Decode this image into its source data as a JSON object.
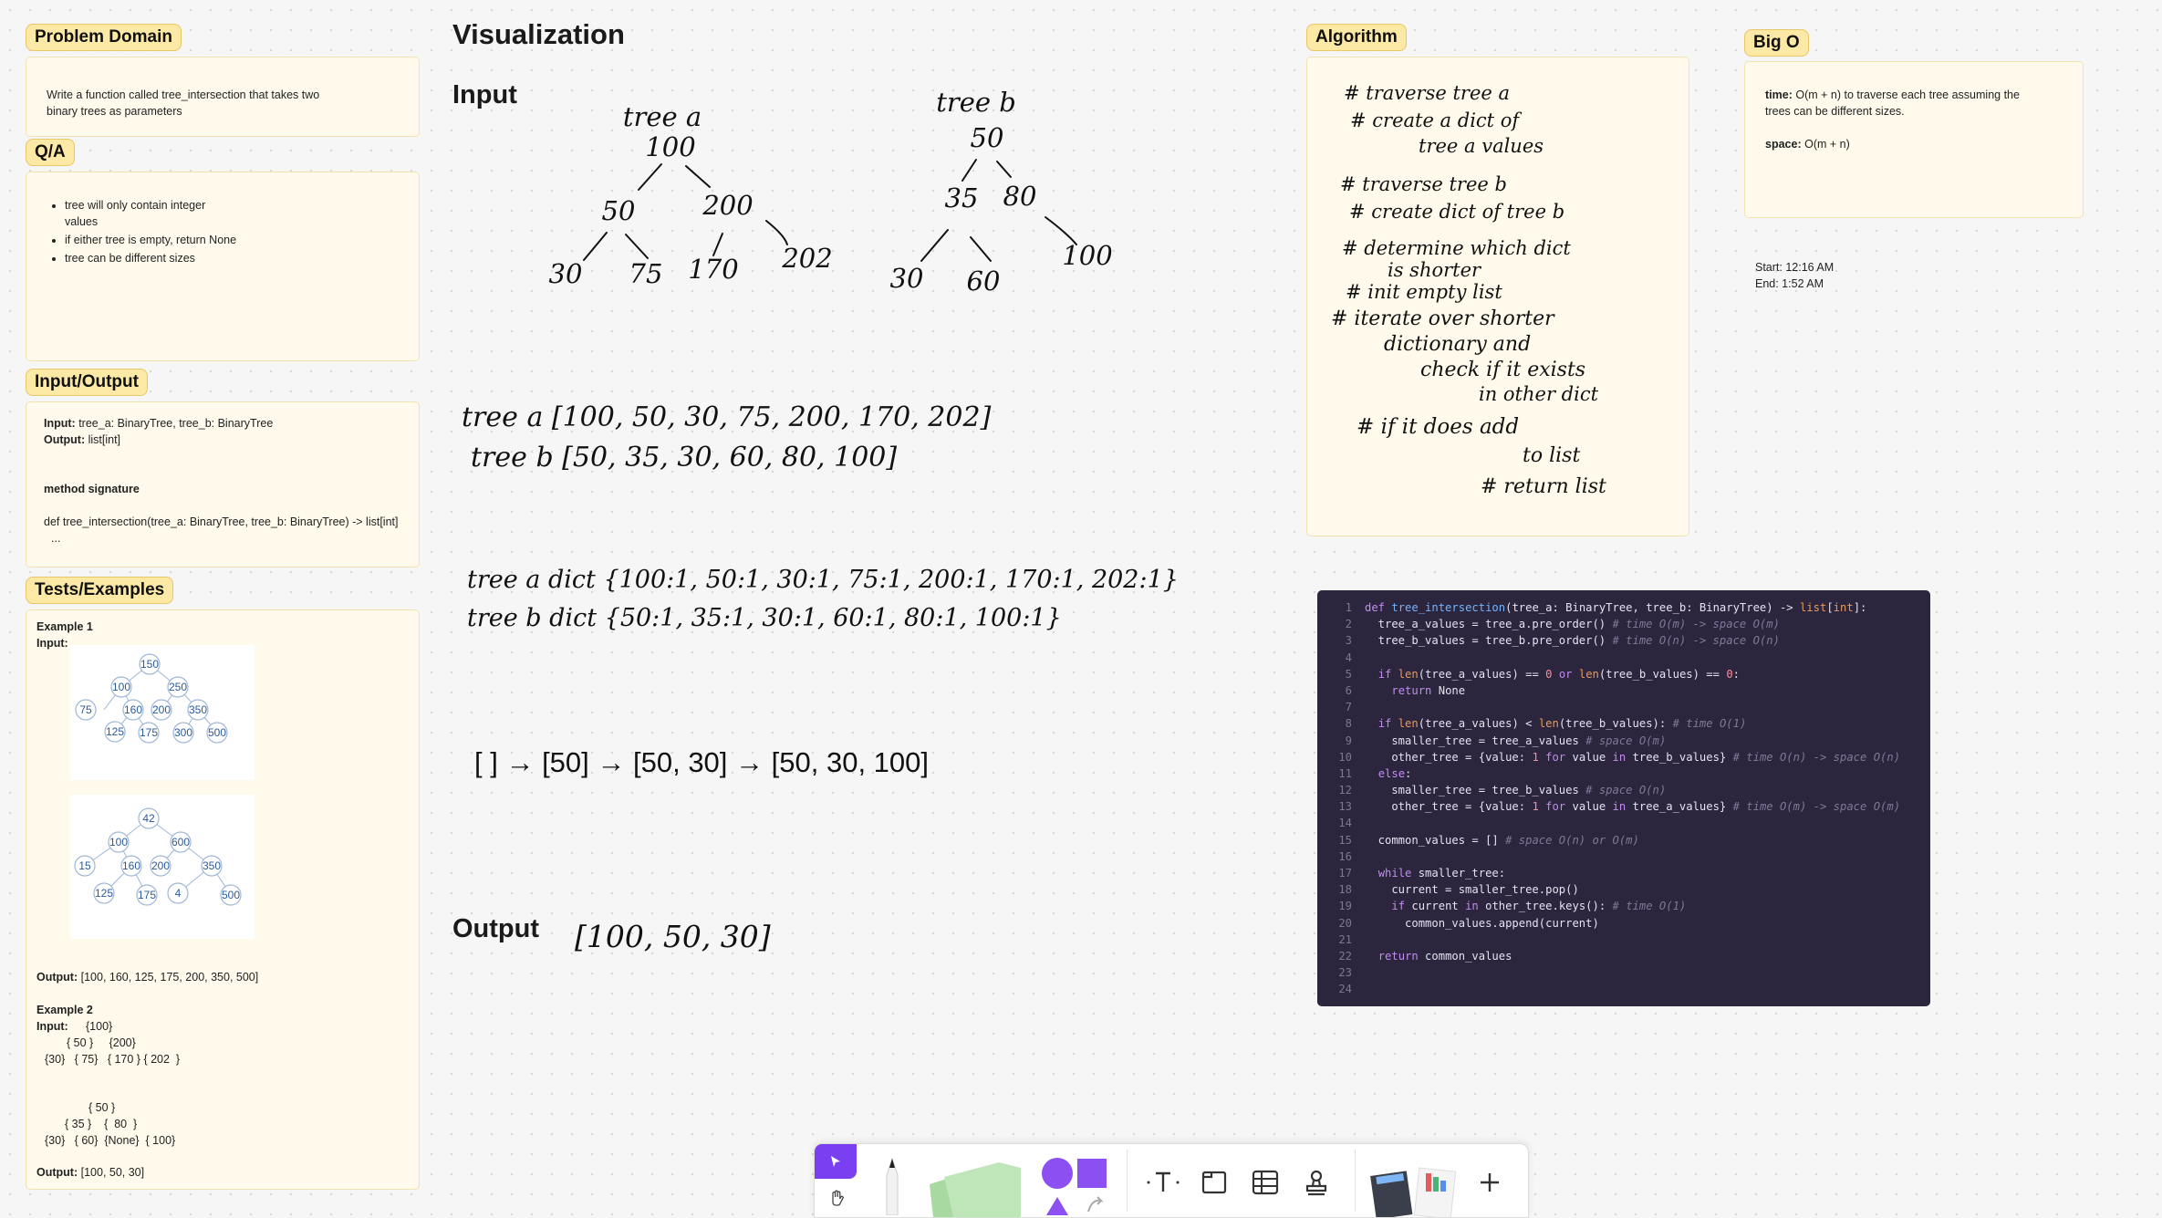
{
  "tags": {
    "problem_domain": "Problem Domain",
    "qa": "Q/A",
    "io": "Input/Output",
    "tests": "Tests/Examples",
    "algorithm": "Algorithm",
    "big_o": "Big O"
  },
  "problem_domain": {
    "text": "Write a function called tree_intersection that takes two binary trees as parameters"
  },
  "qa": {
    "items": [
      "tree will only contain integer values",
      "if either tree is empty, return None",
      "tree can be different sizes"
    ]
  },
  "io": {
    "input_label": "Input:",
    "input_value": "tree_a: BinaryTree, tree_b: BinaryTree",
    "output_label": "Output:",
    "output_value": "list[int]",
    "method_signature_label": "method signature",
    "signature": "def tree_intersection(tree_a: BinaryTree, tree_b: BinaryTree) -> list[int]",
    "ellipsis": "..."
  },
  "tests": {
    "ex1_title": "Example 1",
    "input_label": "Input:",
    "tree1": [
      "150",
      "100",
      "250",
      "75",
      "160",
      "200",
      "350",
      "125",
      "175",
      "300",
      "500"
    ],
    "tree2": [
      "42",
      "100",
      "600",
      "15",
      "160",
      "200",
      "350",
      "125",
      "175",
      "4",
      "500"
    ],
    "ex1_output_label": "Output:",
    "ex1_output": "[100, 160, 125, 175, 200, 350, 500]",
    "ex2_title": "Example 2",
    "ex2_input_label": "Input:",
    "ex2_lines": [
      "{100}",
      "{ 50 }     {200}",
      "{30}   { 75}   { 170 } { 202  }",
      "{ 50 }",
      "{ 35 }    {  80  }",
      "{30}   { 60}  {None}  { 100}"
    ],
    "ex2_output_label": "Output:",
    "ex2_output": "[100, 50, 30]"
  },
  "visualization": {
    "title": "Visualization",
    "input_heading": "Input",
    "output_heading": "Output",
    "tree_a_label": "tree a",
    "tree_b_label": "tree b",
    "tree_a_nodes": [
      "100",
      "50",
      "200",
      "30",
      "75",
      "170",
      "202"
    ],
    "tree_b_nodes": [
      "50",
      "35",
      "80",
      "30",
      "60",
      "100"
    ],
    "tree_a_list": "tree a  [100, 50, 30, 75, 200, 170, 202]",
    "tree_b_list": "tree b  [50, 35, 30, 60, 80, 100]",
    "tree_a_dict": "tree a dict {100:1, 50:1, 30:1, 75:1, 200:1, 170:1, 202:1}",
    "tree_b_dict": "tree b dict {50:1, 35:1, 30:1, 60:1, 80:1, 100:1}",
    "progression": "[ ] → [50] → [50, 30] → [50, 30, 100]",
    "output_value": "[100, 50, 30]"
  },
  "algorithm": {
    "lines": [
      "# traverse tree a",
      "# create a dict of",
      "tree a values",
      "# traverse tree b",
      "# create dict of tree b",
      "# determine which dict",
      "is shorter",
      "# init empty list",
      "# iterate over shorter",
      "dictionary and",
      "check if it exists",
      "in other dict",
      "# if it does add",
      "to list",
      "# return list"
    ]
  },
  "big_o": {
    "time_label": "time:",
    "time_value": "O(m + n) to traverse each tree assuming the trees can be different sizes.",
    "space_label": "space:",
    "space_value": "O(m + n)"
  },
  "timing": {
    "start": "Start: 12:16 AM",
    "end": "End: 1:52 AM"
  },
  "code_lines": [
    "1",
    "2",
    "3",
    "4",
    "5",
    "6",
    "7",
    "8",
    "9",
    "10",
    "11",
    "12",
    "13",
    "14",
    "15",
    "16",
    "17",
    "18",
    "19",
    "20",
    "21",
    "22",
    "23",
    "24"
  ],
  "toolbar": {
    "icons": [
      "select-icon",
      "hand-icon",
      "pen-icon",
      "sticky-note-icon",
      "shapes-icon",
      "text-icon",
      "section-icon",
      "table-icon",
      "stamp-icon",
      "templates-icon",
      "plus-icon"
    ],
    "accent": "#7b3ff2"
  }
}
